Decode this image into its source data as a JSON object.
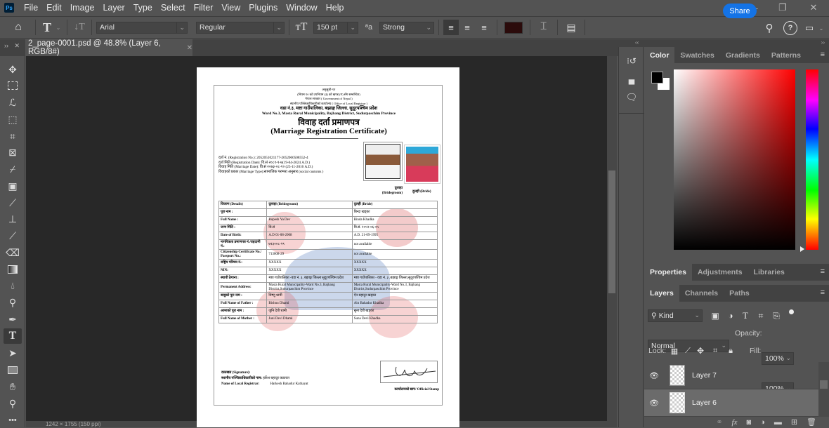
{
  "app": {
    "logo": "Ps",
    "menu": [
      "File",
      "Edit",
      "Image",
      "Layer",
      "Type",
      "Select",
      "Filter",
      "View",
      "Plugins",
      "Window",
      "Help"
    ]
  },
  "options_bar": {
    "font_family": "Arial",
    "font_style": "Regular",
    "font_size": "150 pt",
    "anti_alias": "Strong",
    "text_color": "#2b0b0b",
    "share_label": "Share"
  },
  "document_tab": {
    "title": "2_page-0001.psd @ 48.8% (Layer 6, RGB/8#)"
  },
  "status_bar": {
    "text": "1242 × 1755 (150 ppi)"
  },
  "color_panel": {
    "tabs": [
      "Color",
      "Swatches",
      "Gradients",
      "Patterns"
    ],
    "active": "Color",
    "foreground": "#000000",
    "background": "#ffffff",
    "hue": "#ff0000"
  },
  "properties_panel": {
    "tabs": [
      "Properties",
      "Adjustments",
      "Libraries"
    ],
    "active": "Properties"
  },
  "layers_panel": {
    "tabs": [
      "Layers",
      "Channels",
      "Paths"
    ],
    "active": "Layers",
    "filter": "Kind",
    "blend_mode": "Normal",
    "opacity_label": "Opacity:",
    "opacity": "100%",
    "lock_label": "Lock:",
    "fill_label": "Fill:",
    "fill": "100%",
    "layers": [
      {
        "name": "Layer 7",
        "visible": true,
        "selected": false
      },
      {
        "name": "Layer 6",
        "visible": true,
        "selected": true
      }
    ]
  },
  "certificate": {
    "header": [
      "अनुसूची-११",
      "(नियम १० को उपनियम (३) को खण्ड (ग) सँग सम्बन्धित)",
      "नेपाल सरकार ( Government of Nepal )",
      "स्थानीय पञ्जिकाधिकारीको कार्यालय ( Office of Local Registrar )",
      "वडा नं.३, मष्टा गाउँपालिका, बझाङ्ग जिल्ला, सुदूरपश्चिम प्रदेश",
      "Ward No.3, Masta Rural Municipality, Bajhang District, Sudurpaschim Province"
    ],
    "title_np": "विवाह दर्ता प्रमाणपत्र",
    "title_en": "(Marriage Registration Certificate)",
    "reg_lines": [
      "दर्ता नं. (Registration No.): 2052051021177-2052060508552-4",
      "दर्ता मिति (Registration Date): वि.सं २०८१-१-७(19-04-2024 A.D.)",
      "विवाह मिति (Marriage Date): वि.सं २०७३-०८-१० (25-11-2016 A.D.)",
      "विवाहको प्रकार (Marriage Type):सामाजिक परम्परा अनुसार (social customs )"
    ],
    "groom_caption": "दुलाहा (Bridegroom)",
    "bride_caption": "दुलही (Bride)",
    "table_header": [
      "विवरण (Details)",
      "दुलाहा (Bridegroom)",
      "दुलही (Bride)"
    ],
    "rows": [
      [
        "पूरा नाम :",
        "",
        "बिन्दा खड्का"
      ],
      [
        "Full Name :",
        "Rupesh Ya Dev",
        "Binda Khadka"
      ],
      [
        "जन्म मिति :",
        "वि.सं",
        "वि.सं. २०५२-०६-०५"
      ],
      [
        "Date of Birth:",
        "A.D 01-08-2008",
        "A.D. 21-09-1995"
      ],
      [
        "नागरिकता प्रमाणपत्र नं./राहदानी नं.:",
        "७१३००८-२९",
        "not available"
      ],
      [
        "Citizenship Certificate No./ Passport No.:",
        "713008-29",
        "not available"
      ],
      [
        "राष्ट्रिय परिचय नं.:",
        "XXXXX",
        "XXXXX"
      ],
      [
        "NIN:",
        "XXXXX",
        "XXXXX"
      ],
      [
        "स्थायी ठेगाना :",
        "मष्टा गाउँपालिका -वडा नं. ३, बझाङ्ग जिल्ला सुदूरपश्चिम प्रदेश",
        "मष्टा गाउँपालिका - वडा नं. ३ ,बझाङ्ग जिल्ला,सुदूरपश्चिम प्रदेश"
      ],
      [
        "Permanent Address:",
        "Masta Rural Municipality-Ward No.3, Bajhang District,Sudurpaschim Province",
        "Masta Rural Municipality-Ward No.3, Bajhang District,Sudurpaschim Province"
      ],
      [
        "बाबुको पूरा नाम :",
        "विष्णु धामी",
        "ऐन बहादुर खड्का"
      ],
      [
        "Full Name of Father :",
        "Bishnu Dhami",
        "Ain Bahadur Khadka"
      ],
      [
        "आमाको पूरा नाम :",
        "जुनि देवी धामी",
        "सुना देवी खड्का"
      ],
      [
        "Full Name of Mother :",
        "Juni Devi Dhami",
        "Suna Devi Khadka"
      ]
    ],
    "signature_label": "दस्तखत (Signature):",
    "registrar_np_label": "स्थानीय पञ्जिकाधिकारीको नाम:",
    "registrar_np": "हर्केश बहादुर कठायत",
    "registrar_en_label": "Name of Local Registrar:",
    "registrar_en": "Harkesh Bahadur Kathayat",
    "stamp_label": "कार्यालयको छाप/ Official Stamp"
  }
}
